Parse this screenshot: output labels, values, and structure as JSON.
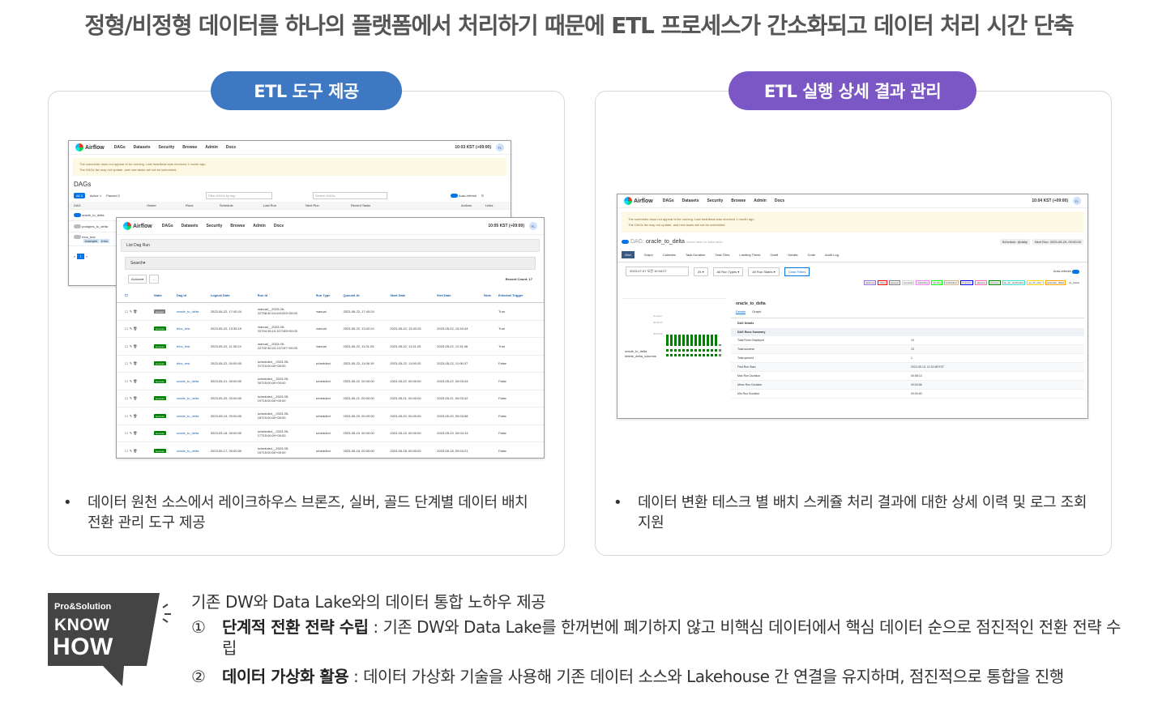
{
  "headline": "정형/비정형 데이터를 하나의 플랫폼에서 처리하기 때문에 ETL 프로세스가 간소화되고 데이터 처리 시간 단축",
  "left_panel": {
    "pill": "ETL 도구 제공",
    "bullet": "데이터 원천 소스에서 레이크하우스 브론즈, 실버, 골드 단계별 데이터 배치 전환 관리 도구 제공"
  },
  "right_panel": {
    "pill": "ETL 실행 상세 결과 관리",
    "bullet": "데이터 변환 테스크 별 배치 스케쥴 처리 결과에 대한 상세 이력 및 로그 조회 지원"
  },
  "airflow": {
    "logo": "Airflow",
    "menu": [
      "DAGs",
      "Datasets",
      "Security",
      "Browse",
      "Admin",
      "Docs"
    ],
    "time_back": "10:03 KST (+09:00)",
    "time_front": "10:05 KST (+09:00)",
    "time_right": "10:04 KST (+09:00)",
    "avatar": "FL",
    "warn1": "The scheduler does not appear to be running. Last heartbeat was received 1 month ago.",
    "warn2": "The DAGs list may not update, and new tasks will not be scheduled.",
    "dags_title": "DAGs",
    "filters": [
      "All",
      "Active",
      "Paused"
    ],
    "filter_counts": [
      "3",
      "1",
      "2"
    ],
    "filter_tag_placeholder": "Filter DAGs by tag",
    "search_placeholder": "Search DAGs",
    "autorefresh": "Auto-refresh",
    "dag_cols": [
      "DAG",
      "Owner",
      "Runs",
      "Schedule",
      "Last Run",
      "Next Run",
      "Recent Tasks",
      "Actions",
      "Links"
    ],
    "dag_rows": [
      "oracle_to_delta",
      "postgres_to_delta",
      "trino_test"
    ],
    "dag_tags": [
      "example",
      "trino"
    ],
    "list_title": "List Dag Run",
    "search_label": "Search",
    "actions_label": "Actions",
    "record_count": "Record Count: 17",
    "run_cols": [
      "State",
      "Dag Id",
      "Logical Date",
      "Run Id",
      "Run Type",
      "Queued At",
      "Start Date",
      "End Date",
      "Note",
      "External Trigger"
    ],
    "runs": [
      {
        "state": "queued",
        "dag": "oracle_to_delta",
        "logical": "2023-06-22, 17:40:24",
        "runid": "manual__2023-06-22T08:40:24.641033+00:00",
        "type": "manual",
        "queued": "2023-06-22, 17:40:24",
        "start": "",
        "end": "",
        "ext": "True"
      },
      {
        "state": "success",
        "dag": "trino_test",
        "logical": "2023-05-22, 13:35:19",
        "runid": "manual__2023-05-22T04:35:19.327189+00:00",
        "type": "manual",
        "queued": "2023-05-22, 13:42:24",
        "start": "2023-05-22, 13:42:25",
        "end": "2023-05-22, 13:42:44",
        "ext": "True"
      },
      {
        "state": "success",
        "dag": "trino_test",
        "logical": "2023-05-22, 11:30:24",
        "runid": "manual__2023-05-22T02:30:24.137157+00:00",
        "type": "manual",
        "queued": "2023-05-22, 11:31:25",
        "start": "2023-05-22, 11:31:25",
        "end": "2023-05-22, 11:31:46",
        "ext": "True"
      },
      {
        "state": "success",
        "dag": "trino_test",
        "logical": "2023-05-22, 00:00:00",
        "runid": "scheduled__2023-05-21T15:00:00+00:00",
        "type": "scheduled",
        "queued": "2023-05-22, 11:06:19",
        "start": "2023-05-22, 11:06:20",
        "end": "2023-05-22, 11:06:37",
        "ext": "False"
      },
      {
        "state": "success",
        "dag": "oracle_to_delta",
        "logical": "2023-05-21, 00:00:00",
        "runid": "scheduled__2023-05-20T15:00:00+00:00",
        "type": "scheduled",
        "queued": "2023-05-22, 00:00:00",
        "start": "2023-05-22, 00:00:00",
        "end": "2023-05-22, 00:03:43",
        "ext": "False"
      },
      {
        "state": "success",
        "dag": "oracle_to_delta",
        "logical": "2023-05-20, 00:00:00",
        "runid": "scheduled__2023-05-19T15:00:00+00:00",
        "type": "scheduled",
        "queued": "2023-05-21, 00:00:00",
        "start": "2023-05-21, 00:00:00",
        "end": "2023-05-21, 00:03:42",
        "ext": "False"
      },
      {
        "state": "success",
        "dag": "oracle_to_delta",
        "logical": "2023-05-19, 00:00:00",
        "runid": "scheduled__2023-05-18T15:00:00+00:00",
        "type": "scheduled",
        "queued": "2023-05-20, 00:00:00",
        "start": "2023-05-20, 00:00:00",
        "end": "2023-05-20, 00:03:58",
        "ext": "False"
      },
      {
        "state": "success",
        "dag": "oracle_to_delta",
        "logical": "2023-05-18, 00:00:00",
        "runid": "scheduled__2023-05-17T15:00:00+00:00",
        "type": "scheduled",
        "queued": "2023-05-19, 00:00:00",
        "start": "2023-05-19, 00:00:00",
        "end": "2023-05-19, 00:04:13",
        "ext": "False"
      },
      {
        "state": "success",
        "dag": "oracle_to_delta",
        "logical": "2023-05-17, 00:00:00",
        "runid": "scheduled__2023-05-16T15:00:00+00:00",
        "type": "scheduled",
        "queued": "2023-05-18, 00:00:00",
        "start": "2023-05-18, 00:00:00",
        "end": "2023-05-18, 00:04:21",
        "ext": "False"
      }
    ],
    "detail": {
      "dag_prefix": "DAG:",
      "dag_name": "oracle_to_delta",
      "dag_desc": "oracle table to delta table",
      "schedule": "Schedule: @daily",
      "next_run": "Next Run: 2023-05-29, 00:00:00",
      "tabs": [
        "Grid",
        "Graph",
        "Calendar",
        "Task Duration",
        "Task Tries",
        "Landing Times",
        "Gantt",
        "Details",
        "Code",
        "Audit Log"
      ],
      "date_value": "2023-07-07 오전 10:04:27",
      "runs_count": "25",
      "run_types": "All Run Types",
      "run_states": "All Run States",
      "clear_filters": "Clear Filters",
      "auto_refresh": "Auto-refresh",
      "states": [
        "deferred",
        "failed",
        "queued",
        "removed",
        "restarting",
        "running",
        "scheduled",
        "shutdown",
        "skipped",
        "success",
        "up_for_reschedule",
        "up_for_retry",
        "upstream_failed",
        "no_status"
      ],
      "tasks": [
        "oracle_to_delta",
        "delete_delta_columns"
      ],
      "dag_label": "oracle_to_delta",
      "sub_tabs": [
        "Details",
        "Graph"
      ],
      "summary_title": "DAG Details",
      "summary_header": "DAG Runs Summary",
      "summary": [
        {
          "k": "Total Runs Displayed",
          "v": "14"
        },
        {
          "k": "Total success",
          "v": "13"
        },
        {
          "k": "Total queued",
          "v": "1"
        },
        {
          "k": "First Run Start",
          "v": "2023-05-13, 11:22:08 KST"
        },
        {
          "k": "Max Run Duration",
          "v": "00:08:13"
        },
        {
          "k": "Mean Run Duration",
          "v": "00:04:06"
        },
        {
          "k": "Min Run Duration",
          "v": "00:00:00"
        }
      ],
      "duration_label": "Duration",
      "chart_ticks": [
        "00:08:13",
        "00:04:06"
      ]
    }
  },
  "knowhow": {
    "badge_top": "Pro&Solution",
    "badge_l1": "KNOW",
    "badge_l2": "HOW",
    "title": "기존 DW와 Data Lake와의 데이터 통합 노하우 제공",
    "items": [
      {
        "num": "①",
        "bold": "단계적 전환 전략 수립",
        "text": " : 기존 DW와 Data Lake를 한꺼번에 폐기하지 않고 비핵심 데이터에서 핵심 데이터 순으로 점진적인 전환 전략 수립"
      },
      {
        "num": "②",
        "bold": "데이터 가상화 활용",
        "text": " : 데이터 가상화 기술을 사용해 기존 데이터 소스와 Lakehouse 간 연결을 유지하며, 점진적으로 통합을 진행"
      }
    ]
  },
  "colors": {
    "blue_pill": "#3f78c2",
    "purple_pill": "#7b57c6",
    "success": "#008000",
    "queued": "#808080"
  }
}
